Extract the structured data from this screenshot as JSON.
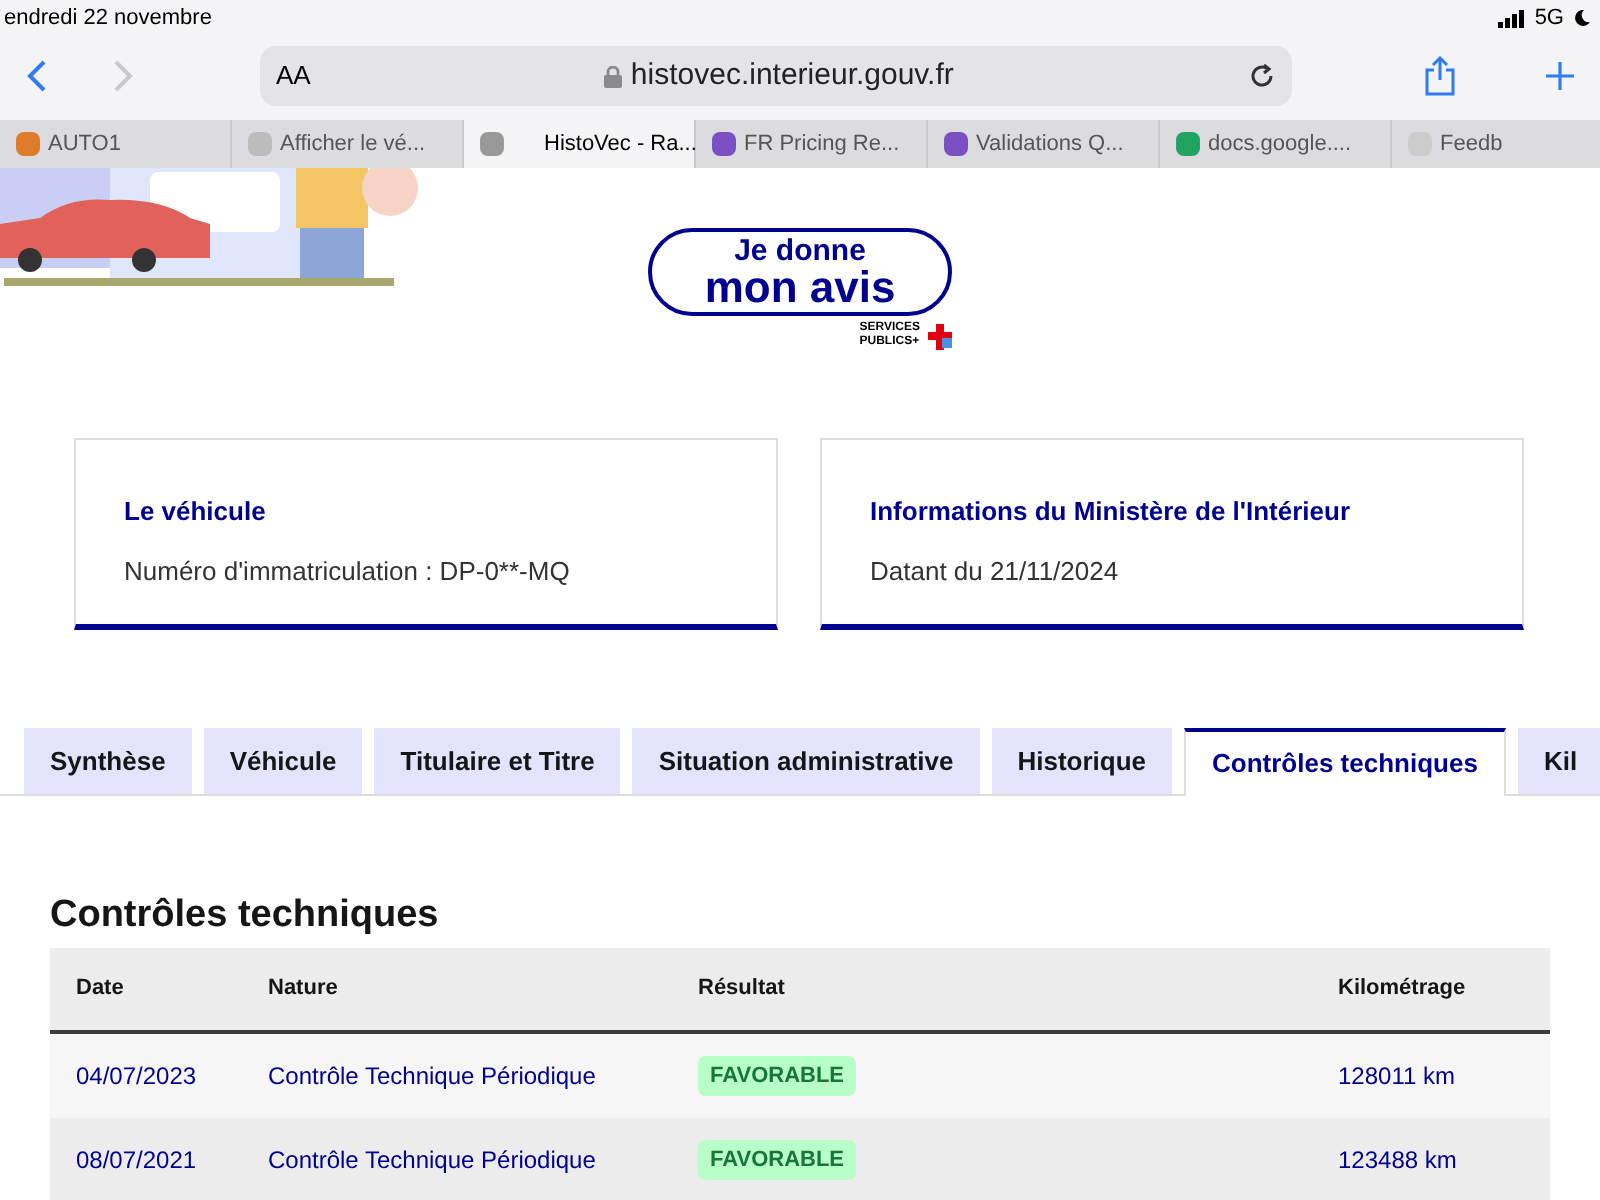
{
  "status_bar": {
    "date": "endredi 22 novembre",
    "network": "5G"
  },
  "browser": {
    "text_size": "AA",
    "url": "histovec.interieur.gouv.fr",
    "tabs": [
      {
        "title": "AUTO1",
        "selected": false,
        "color": "#e07b2a"
      },
      {
        "title": "Afficher le vé...",
        "selected": false,
        "color": "#bcbcbc"
      },
      {
        "title": "HistoVec - Ra...",
        "selected": true,
        "color": "#999999"
      },
      {
        "title": "FR Pricing Re...",
        "selected": false,
        "color": "#7b4fc4"
      },
      {
        "title": "Validations Q...",
        "selected": false,
        "color": "#7b4fc4"
      },
      {
        "title": "docs.google....",
        "selected": false,
        "color": "#1fa463"
      },
      {
        "title": "Feedb",
        "selected": false,
        "color": "#cccccc"
      }
    ]
  },
  "feedback_button": {
    "line1": "Je donne",
    "line2": "mon avis",
    "logo": [
      "SERVICES",
      "PUBLICS+"
    ]
  },
  "cards": [
    {
      "title": "Le véhicule",
      "text": "Numéro d'immatriculation : DP-0**-MQ"
    },
    {
      "title": "Informations du Ministère de l'Intérieur",
      "text": "Datant du 21/11/2024"
    }
  ],
  "tabs": [
    {
      "label": "Synthèse",
      "selected": false
    },
    {
      "label": "Véhicule",
      "selected": false
    },
    {
      "label": "Titulaire et Titre",
      "selected": false
    },
    {
      "label": "Situation administrative",
      "selected": false
    },
    {
      "label": "Historique",
      "selected": false
    },
    {
      "label": "Contrôles techniques",
      "selected": true
    },
    {
      "label": "Kil",
      "selected": false
    }
  ],
  "section_title": "Contrôles techniques",
  "table": {
    "columns": [
      "Date",
      "Nature",
      "Résultat",
      "Kilométrage"
    ],
    "rows": [
      {
        "date": "04/07/2023",
        "nature": "Contrôle Technique Périodique",
        "result": "FAVORABLE",
        "km": "128011 km"
      },
      {
        "date": "08/07/2021",
        "nature": "Contrôle Technique Périodique",
        "result": "FAVORABLE",
        "km": "123488 km"
      }
    ]
  }
}
